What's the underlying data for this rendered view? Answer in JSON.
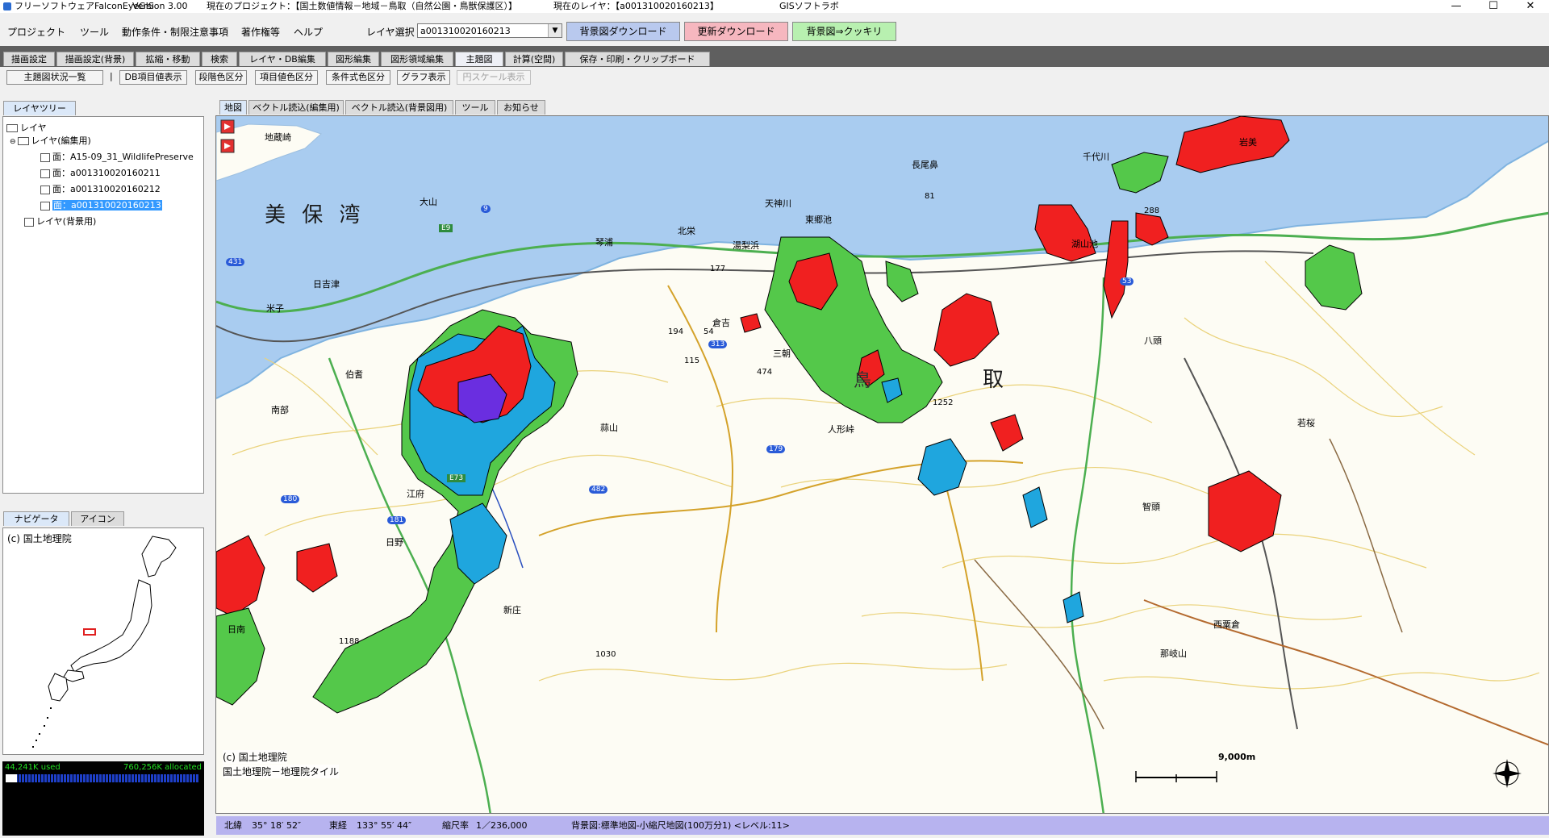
{
  "window": {
    "app_title": "フリーソフトウェアFalconEyeGIS",
    "version": "Version 3.00",
    "project": "現在のプロジェクト：【国土数値情報－地域－鳥取（自然公園・鳥獣保護区）】",
    "current_layer": "現在のレイヤ：【a001310020160213】",
    "vendor": "GISソフトラボ",
    "minimize": "—",
    "maximize": "☐",
    "close": "✕"
  },
  "menu": {
    "items": [
      "プロジェクト",
      "ツール",
      "動作条件・制限注意事項",
      "著作権等",
      "ヘルプ"
    ],
    "layer_select_label": "レイヤ選択",
    "layer_select_value": "a001310020160213",
    "btn_bg_download": "背景図ダウンロード",
    "btn_update_download": "更新ダウンロード",
    "btn_bg_sharpen": "背景図⇒クッキリ"
  },
  "main_tabs": [
    "描画設定",
    "描画設定(背景)",
    "拡縮・移動",
    "検索",
    "レイヤ・DB編集",
    "図形編集",
    "図形領域編集",
    "主題図",
    "計算(空間)",
    "保存・印刷・クリップボード"
  ],
  "toolbar": {
    "btn_summary": "主題図状況一覧",
    "sep": "|",
    "btn_db_value": "DB項目値表示",
    "btn_step_class": "段階色区分",
    "btn_item_class": "項目値色区分",
    "btn_cond_class": "条件式色区分",
    "btn_graph": "グラフ表示",
    "btn_circle_scale": "円スケール表示"
  },
  "layer_panel": {
    "tab": "レイヤツリー",
    "root": "レイヤ",
    "edit_group": "レイヤ(編集用)",
    "layers": [
      "面：A15-09_31_WildlifePreserve",
      "面：a001310020160211",
      "面：a001310020160212",
      "面：a001310020160213"
    ],
    "bg_group": "レイヤ(背景用)"
  },
  "nav_panel": {
    "tabs": [
      "ナビゲータ",
      "アイコン"
    ],
    "credit": "(c) 国土地理院"
  },
  "memory": {
    "used": "44,241K used",
    "allocated": "760,256K allocated"
  },
  "map_tabs": [
    "地図",
    "ベクトル読込(編集用)",
    "ベクトル読込(背景図用)",
    "ツール",
    "お知らせ"
  ],
  "map": {
    "credit1": "(c) 国土地理院",
    "credit2": "国土地理院－地理院タイル",
    "scale_label": "9,000m",
    "labels": {
      "bay": "美 保 湾",
      "tottori": "取",
      "torin": "鳥",
      "iwami": "岩美",
      "yatsuzuka": "八頭",
      "wakasa": "若桜",
      "kotoura": "琴浦",
      "hokuei": "北栄",
      "yurihama": "湯梨浜",
      "misasa": "三朝",
      "kurayoshi": "倉吉",
      "hakusan": "伯耆",
      "nanbu": "南部",
      "kofu": "江府",
      "hino": "日野",
      "nichinan": "日南",
      "shinjo": "新庄",
      "chizu": "智頭",
      "nishiawakura": "西粟倉",
      "daisen": "大山",
      "yonago": "米子",
      "hiezu": "日吉津",
      "nagaobana": "長尾鼻",
      "chiyogawa": "千代川",
      "tenjingawa": "天神川",
      "togo": "東郷池",
      "koyama": "湖山池",
      "hiruzen": "蒜山",
      "hiruzen_r": "人形峠",
      "jizozaki": "地蔵崎",
      "nagisa": "那岐山"
    },
    "heights": [
      "288",
      "177",
      "194",
      "54",
      "115",
      "474",
      "1252",
      "1188",
      "1030",
      "81"
    ],
    "routes": [
      "9",
      "431",
      "313",
      "179",
      "482",
      "180",
      "181",
      "53",
      "E9",
      "E73"
    ]
  },
  "status": {
    "lat_label": "北緯",
    "lat": "35° 18′ 52″",
    "lon_label": "東経",
    "lon": "133° 55′ 44″",
    "scale_label": "縮尺率",
    "scale": "1／236,000",
    "bg_map": "背景図:標準地図-小縮尺地図(100万分1) <レベル:11>"
  },
  "colors": {
    "red": "#f02020",
    "green": "#54c84a",
    "blue": "#1fa6de",
    "purple": "#6a2ee0",
    "sea": "#a9ccf0",
    "status": "#b7b3ef"
  }
}
